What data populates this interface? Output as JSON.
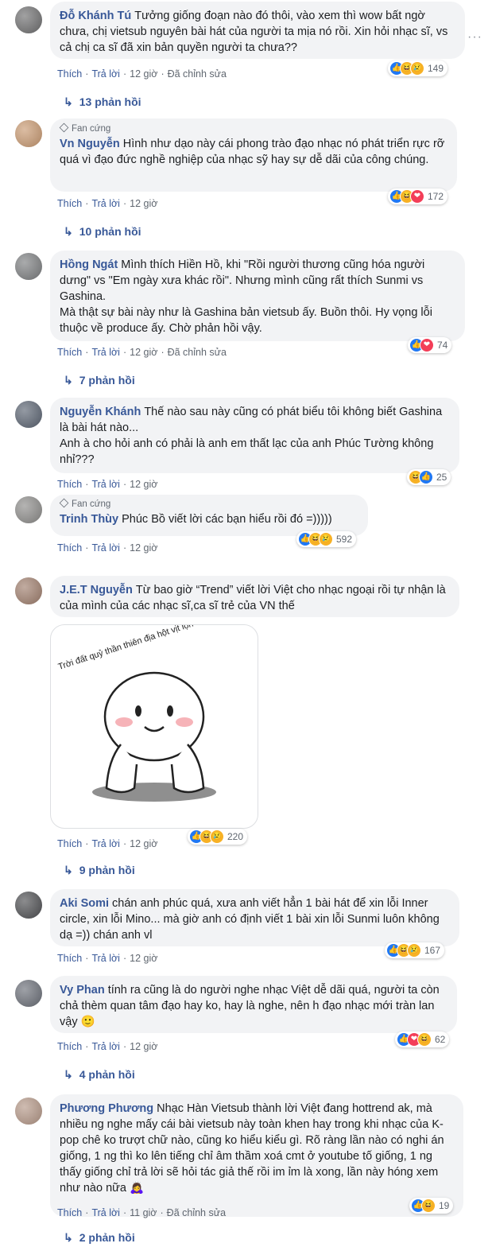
{
  "comments": [
    {
      "name": "Đỗ Khánh Tú",
      "badge": "",
      "text": "Tưởng giống đoạn nào đó thôi, vào xem thì wow bất ngờ chưa, chị vietsub nguyên bài hát của người ta mịa nó rồi. Xin hỏi nhạc sĩ, vs cả chị ca sĩ đã xin bản quyền người ta chưa??",
      "like": "Thích",
      "reply": "Trả lời",
      "time": "12 giờ",
      "edited": "Đã chỉnh sửa",
      "reactions": [
        "like",
        "haha",
        "sad"
      ],
      "count": "149",
      "replies": "13 phản hồi"
    },
    {
      "name": "Vn Nguyễn",
      "badge": "Fan cứng",
      "text": "Hình như dạo này cái phong trào đạo nhạc nó phát triển rực rỡ quá vì đạo đức nghề nghiệp của nhạc sỹ hay sự dễ dãi của công chúng.",
      "like": "Thích",
      "reply": "Trả lời",
      "time": "12 giờ",
      "edited": "",
      "reactions": [
        "like",
        "haha",
        "love"
      ],
      "count": "172",
      "replies": "10 phản hồi"
    },
    {
      "name": "Hồng Ngát",
      "badge": "",
      "text": "Mình thích Hiền Hồ, khi \"Rồi người thương cũng hóa người dưng\" vs \"Em ngày xưa khác rồi\". Nhưng mình cũng rất thích Sunmi vs Gashina.\nMà thật sự bài này như là Gashina bản vietsub ấy. Buồn thôi. Hy vọng lỗi thuộc về produce ấy. Chờ phản hồi vậy.",
      "like": "Thích",
      "reply": "Trả lời",
      "time": "12 giờ",
      "edited": "Đã chỉnh sửa",
      "reactions": [
        "like",
        "love"
      ],
      "count": "74",
      "replies": "7 phản hồi"
    },
    {
      "name": "Nguyễn Khánh",
      "badge": "",
      "text": "Thế nào sau này cũng có phát biểu tôi không biết Gashina là bài hát nào...\nAnh à cho hỏi anh có phải là anh em thất lạc của anh Phúc Tường không nhỉ???",
      "like": "Thích",
      "reply": "Trả lời",
      "time": "12 giờ",
      "edited": "",
      "reactions": [
        "haha",
        "like"
      ],
      "count": "25",
      "replies": ""
    },
    {
      "name": "Trinh Thùy",
      "badge": "Fan cứng",
      "text": "Phúc Bồ viết lời các bạn hiểu rồi đó =)))))",
      "like": "Thích",
      "reply": "Trả lời",
      "time": "12 giờ",
      "edited": "",
      "reactions": [
        "like",
        "haha",
        "sad"
      ],
      "count": "592",
      "replies": ""
    },
    {
      "name": "J.E.T Nguyễn",
      "badge": "",
      "text": "Từ bao giờ “Trend” viết lời Việt cho nhạc ngoại rồi tự nhận là của mình của các nhạc sĩ,ca sĩ trẻ của VN thế",
      "like": "Thích",
      "reply": "Trả lời",
      "time": "12 giờ",
      "edited": "",
      "reactions": [
        "like",
        "haha",
        "sad"
      ],
      "count": "220",
      "replies": "9 phản hồi",
      "sticker_text": "Trời đất quỷ thần thiên địa hột vịt lộn ơi"
    },
    {
      "name": "Aki Somi",
      "badge": "",
      "text": "chán anh phúc quá, xưa anh viết hẳn 1 bài hát để xin lỗi Inner circle, xin lỗi Mino... mà giờ anh có định viết 1 bài xin lỗi Sunmi luôn không dạ =)) chán anh vl",
      "like": "Thích",
      "reply": "Trả lời",
      "time": "12 giờ",
      "edited": "",
      "reactions": [
        "like",
        "haha",
        "sad"
      ],
      "count": "167",
      "replies": ""
    },
    {
      "name": "Vy Phan",
      "badge": "",
      "text": "tính ra cũng là do người nghe nhạc Việt dễ dãi quá, người ta còn chả thèm quan tâm đạo hay ko, hay là nghe, nên h đạo nhạc mới tràn lan vậy 🙂",
      "like": "Thích",
      "reply": "Trả lời",
      "time": "12 giờ",
      "edited": "",
      "reactions": [
        "like",
        "love",
        "haha"
      ],
      "count": "62",
      "replies": "4 phản hồi"
    },
    {
      "name": "Phương Phương",
      "badge": "",
      "text": "Nhạc Hàn Vietsub thành lời Việt đang hottrend ak, mà nhiều ng nghe mấy cái bài vietsub này toàn khen hay trong khi nhạc của K-pop chê ko trượt chữ nào, cũng ko hiểu kiểu gì. Rõ ràng lần nào có nghi án giống, 1 ng thì ko lên tiếng chỉ âm thầm xoá cmt ở youtube tố giống, 1 ng thấy giống chỉ trả lời sẽ hỏi tác giả thế rồi im ỉm là xong, lần này hóng xem như nào nữa 🙇‍♀️",
      "like": "Thích",
      "reply": "Trả lời",
      "time": "11 giờ",
      "edited": "Đã chỉnh sửa",
      "reactions": [
        "like",
        "haha"
      ],
      "count": "19",
      "replies": "2 phản hồi"
    }
  ],
  "more_icon": "···",
  "colors": {
    "name": "#385898",
    "bubble": "#f2f3f5",
    "meta": "#606770",
    "like": "#2078f4",
    "love": "#f33e58",
    "haha": "#f7b125"
  }
}
